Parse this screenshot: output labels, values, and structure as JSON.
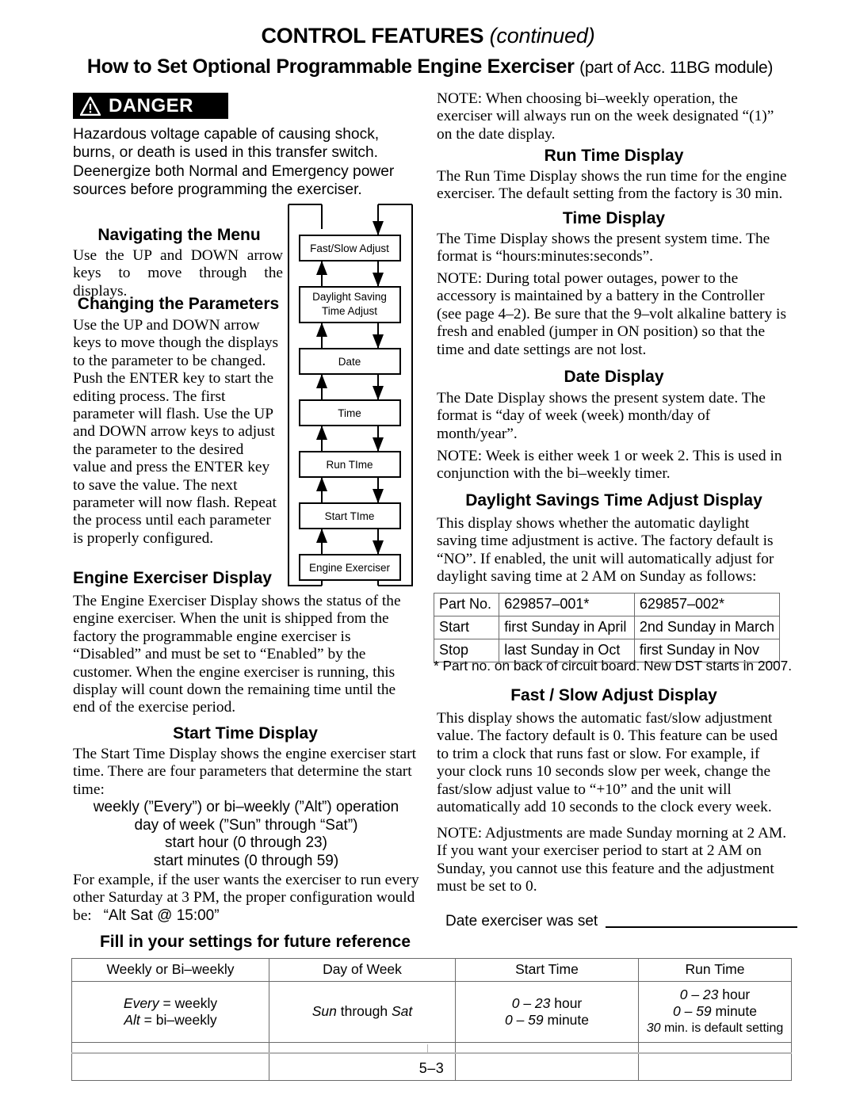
{
  "header": {
    "title_main": "CONTROL FEATURES",
    "title_continued": "(continued)",
    "subtitle": "How to Set Optional Programmable Engine Exerciser",
    "subtitle_note": "(part of Acc. 11BG module)"
  },
  "danger": {
    "label": "DANGER",
    "icon": "warning-triangle-icon",
    "text": "Hazardous voltage capable of causing shock, burns, or death is used in this transfer switch. Deenergize both Normal and Emergency power sources before programming the exerciser."
  },
  "left_column": {
    "navigating": {
      "heading": "Navigating the Menu",
      "body": "Use the UP and DOWN arrow keys to move through the displays."
    },
    "changing": {
      "heading": "Changing the Parameters",
      "body": "Use the UP and DOWN arrow keys to move though the displays to the parameter to be changed. Push the ENTER key to start the editing process.  The first parameter will flash.  Use the UP and DOWN arrow keys to adjust the parameter to the desired value and press the ENTER key to save the value.  The next parameter will now flash.  Repeat the process until each parameter is properly configured."
    },
    "engine_exerciser": {
      "heading": "Engine Exerciser Display",
      "body": "The Engine Exerciser Display shows the status of the engine exerciser.  When the unit is shipped from the factory the programmable engine exerciser is “Disabled” and must be set to “Enabled” by the customer.  When the engine exerciser is running, this display will count down the remaining time until the end of the exercise period."
    },
    "start_time": {
      "heading": "Start Time Display",
      "body": "The Start Time Display shows the engine exerciser start time.  There are four parameters that determine the start time:",
      "parameters": [
        "weekly (”Every”) or bi–weekly (”Alt”) operation",
        "day of week (”Sun” through “Sat”)",
        "start hour (0 through 23)",
        "start minutes (0 through 59)"
      ],
      "example": "For example, if the user wants the exerciser to run every other Saturday at 3 PM, the proper configuration would be:",
      "example_value": "“Alt Sat @ 15:00”"
    }
  },
  "flowchart": {
    "name": "menu-navigation-flowchart",
    "boxes": [
      "Fast/Slow Adjust",
      "Daylight Saving\nTime Adjust",
      "Date",
      "Time",
      "Run TIme",
      "Start TIme",
      "Engine Exerciser"
    ],
    "box_labels": [
      {
        "line1": "Fast/Slow Adjust",
        "line2": ""
      },
      {
        "line1": "Daylight Saving",
        "line2": "Time Adjust"
      },
      {
        "line1": "Date",
        "line2": ""
      },
      {
        "line1": "Time",
        "line2": ""
      },
      {
        "line1": "Run TIme",
        "line2": ""
      },
      {
        "line1": "Start TIme",
        "line2": ""
      },
      {
        "line1": "Engine Exerciser",
        "line2": ""
      }
    ]
  },
  "right_column": {
    "note_biweekly": "NOTE:  When choosing bi–weekly operation, the exerciser will always run on the week designated “(1)” on the date display.",
    "run_time": {
      "heading": "Run Time Display",
      "body": "The Run Time Display shows the run time for the engine exerciser.  The default setting from the factory is 30 min."
    },
    "time": {
      "heading": "Time Display",
      "body": "The Time Display shows the present system time. The format is “hours:minutes:seconds”.",
      "note": "NOTE:  During total power outages, power to the accessory is maintained by a battery in the Controller (see page 4–2).  Be sure that the 9–volt alkaline battery is fresh and enabled (jumper in ON position) so that the time and date settings are not lost."
    },
    "date": {
      "heading": "Date Display",
      "body": "The Date Display shows the present system date.  The format is “day of week (week) month/day of month/year”.",
      "note": "NOTE: Week is either week 1 or week 2.  This is used in conjunction with the bi–weekly timer."
    },
    "dst": {
      "heading": "Daylight Savings Time Adjust Display",
      "body": "This display shows whether the automatic daylight saving time adjustment is active.  The factory default is “NO”.  If enabled, the unit will automatically adjust for daylight saving time at 2 AM on Sunday as follows:",
      "table": {
        "rows": [
          [
            "Part No.",
            "629857–001*",
            "629857–002*"
          ],
          [
            "Start",
            "first Sunday in April",
            "2nd Sunday in March"
          ],
          [
            "Stop",
            "last Sunday in Oct",
            "first Sunday in Nov"
          ]
        ]
      },
      "footnote": "* Part no. on back of circuit board.  New DST starts in 2007."
    },
    "fast_slow": {
      "heading": "Fast / Slow Adjust Display",
      "body": "This display shows the automatic fast/slow adjustment value.  The factory default is 0.  This feature can be used to trim a clock that runs fast or slow.  For example, if your clock runs 10 seconds slow per week, change the fast/slow adjust value to “+10” and the unit will automatically add 10 seconds to the clock every week.",
      "note": "NOTE: Adjustments are made Sunday morning at 2 AM.  If you want your exerciser period to start at 2 AM on Sunday, you cannot use this feature and the adjustment must be set to 0."
    },
    "date_set_label": "Date exerciser was set"
  },
  "fill_in": {
    "heading": "Fill in your settings for future reference",
    "headers": [
      "Weekly or Bi–weekly",
      "Day of Week",
      "Start Time",
      "Run Time"
    ],
    "values": {
      "weekly_line1_em": "Every",
      "weekly_line1_rest": " = weekly",
      "weekly_line2_em": "Alt",
      "weekly_line2_rest": " = bi–weekly",
      "day_em1": "Sun",
      "day_mid": " through ",
      "day_em2": "Sat",
      "start_line1_em": "0 – 23",
      "start_line1_rest": " hour",
      "start_line2_em": "0 – 59",
      "start_line2_rest": " minute",
      "run_line1_em": "0 – 23",
      "run_line1_rest": " hour",
      "run_line2_em": "0 – 59",
      "run_line2_rest": " minute",
      "run_line3_em": "30",
      "run_line3_rest": " min. is default setting"
    }
  },
  "footer": {
    "page_number": "5–3"
  }
}
